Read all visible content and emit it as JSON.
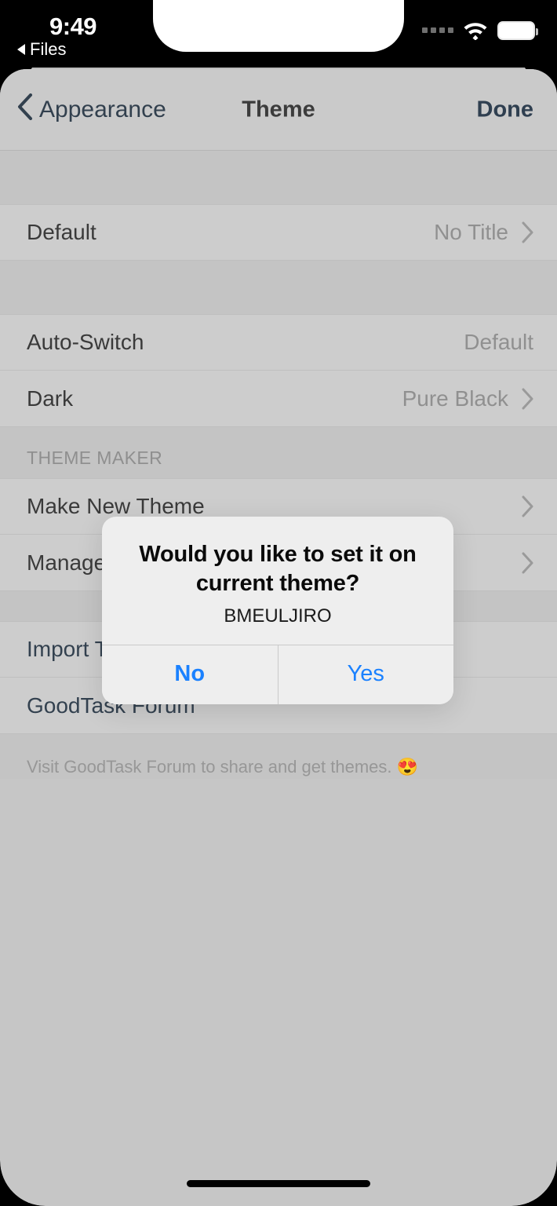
{
  "statusbar": {
    "time": "9:49",
    "back_label": "Files",
    "wifi_icon": "wifi-icon",
    "battery_icon": "battery-icon",
    "signal_icon": "signal-dots-icon"
  },
  "navbar": {
    "back_label": "Appearance",
    "title": "Theme",
    "done_label": "Done",
    "back_icon": "chevron-left-icon"
  },
  "sections": [
    {
      "header": "",
      "rows": [
        {
          "label": "Default",
          "value": "No Title",
          "chevron": true,
          "link": false
        }
      ]
    },
    {
      "header": "",
      "rows": [
        {
          "label": "Auto-Switch",
          "value": "Default",
          "chevron": false,
          "link": false
        },
        {
          "label": "Dark",
          "value": "Pure Black",
          "chevron": true,
          "link": false
        }
      ]
    },
    {
      "header": "THEME MAKER",
      "rows": [
        {
          "label": "Make New Theme",
          "value": "",
          "chevron": true,
          "link": false
        },
        {
          "label": "Manage Themes",
          "value": "",
          "chevron": true,
          "link": false
        }
      ]
    },
    {
      "header": "",
      "rows": [
        {
          "label": "Import Theme",
          "value": "",
          "chevron": false,
          "link": true
        },
        {
          "label": "GoodTask Forum",
          "value": "",
          "chevron": false,
          "link": true
        }
      ]
    }
  ],
  "footnote": "Visit GoodTask Forum to share and get themes. 😍",
  "dialog": {
    "title": "Would you like to set it on current theme?",
    "subtitle": "BMEULJIRO",
    "no_label": "No",
    "yes_label": "Yes"
  },
  "colors": {
    "background": "#c6c6c6",
    "row": "#cdcdcd",
    "accent_blue": "#1a81ff",
    "nav_text": "#32404e",
    "dialog_bg": "#eeeeee"
  }
}
